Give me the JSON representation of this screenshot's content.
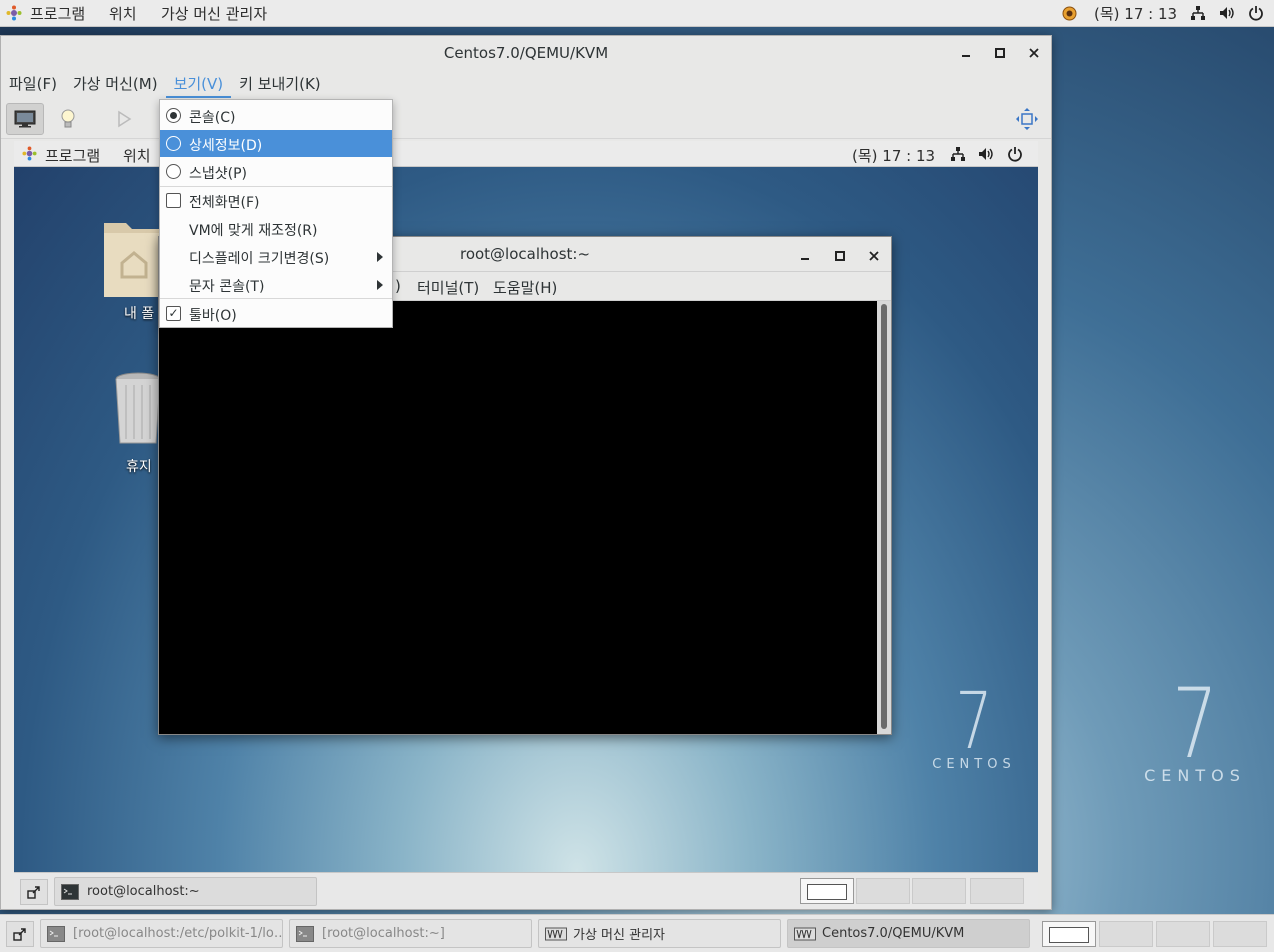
{
  "host_topbar": {
    "apps_label": "프로그램",
    "places_label": "위치",
    "virt_manager_label": "가상 머신 관리자",
    "clock": "(목) 17 : 13"
  },
  "viewer": {
    "title": "Centos7.0/QEMU/KVM",
    "menu": [
      "파일(F)",
      "가상 머신(M)",
      "보기(V)",
      "키 보내기(K)"
    ],
    "active_menu_index": 2
  },
  "view_menu": {
    "items": [
      {
        "label": "콘솔(C)",
        "kind": "radio",
        "checked": true
      },
      {
        "label": "상세정보(D)",
        "kind": "radio",
        "checked": false,
        "highlighted": true
      },
      {
        "label": "스냅샷(P)",
        "kind": "radio",
        "checked": false
      },
      {
        "label": "전체화면(F)",
        "kind": "check",
        "checked": false
      },
      {
        "label": "VM에 맞게 재조정(R)",
        "kind": "plain"
      },
      {
        "label": "디스플레이 크기변경(S)",
        "kind": "submenu"
      },
      {
        "label": "문자 콘솔(T)",
        "kind": "submenu"
      },
      {
        "label": "툴바(O)",
        "kind": "check",
        "checked": true
      }
    ]
  },
  "guest": {
    "topbar": {
      "apps_label": "프로그램",
      "places_label": "위치",
      "clock": "(목) 17 : 13"
    },
    "desktop_icons": [
      {
        "label": "내 폴",
        "icon": "home-folder-icon"
      },
      {
        "label": "휴지",
        "icon": "trash-icon"
      }
    ],
    "terminal": {
      "title": "root@localhost:~",
      "menu_visible": [
        ")",
        "터미널(T)",
        "도움말(H)"
      ]
    },
    "taskbar": {
      "task": "root@localhost:~"
    },
    "watermark": {
      "number": "7",
      "word": "CENTOS"
    }
  },
  "host_taskbar": {
    "tasks": [
      "[root@localhost:/etc/polkit-1/lo…",
      "[root@localhost:~]",
      "가상 머신 관리자",
      "Centos7.0/QEMU/KVM"
    ],
    "active_task_index": 3
  },
  "host_watermark": {
    "number": "7",
    "word": "CENTOS"
  }
}
